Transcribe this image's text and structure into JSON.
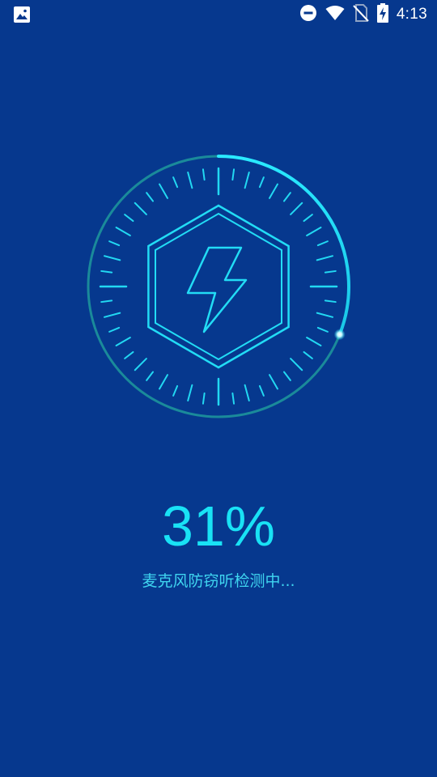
{
  "status_bar": {
    "time": "4:13",
    "icons": [
      "image-notification-icon",
      "do-not-disturb-icon",
      "wifi-icon",
      "no-sim-icon",
      "battery-charging-icon"
    ]
  },
  "scan": {
    "progress": 0.31,
    "percent_label": "31%",
    "message": "麦克风防窃听检测中..."
  },
  "colors": {
    "background": "#06388e",
    "accent": "#19e2f5",
    "track": "#1a8a9a"
  }
}
